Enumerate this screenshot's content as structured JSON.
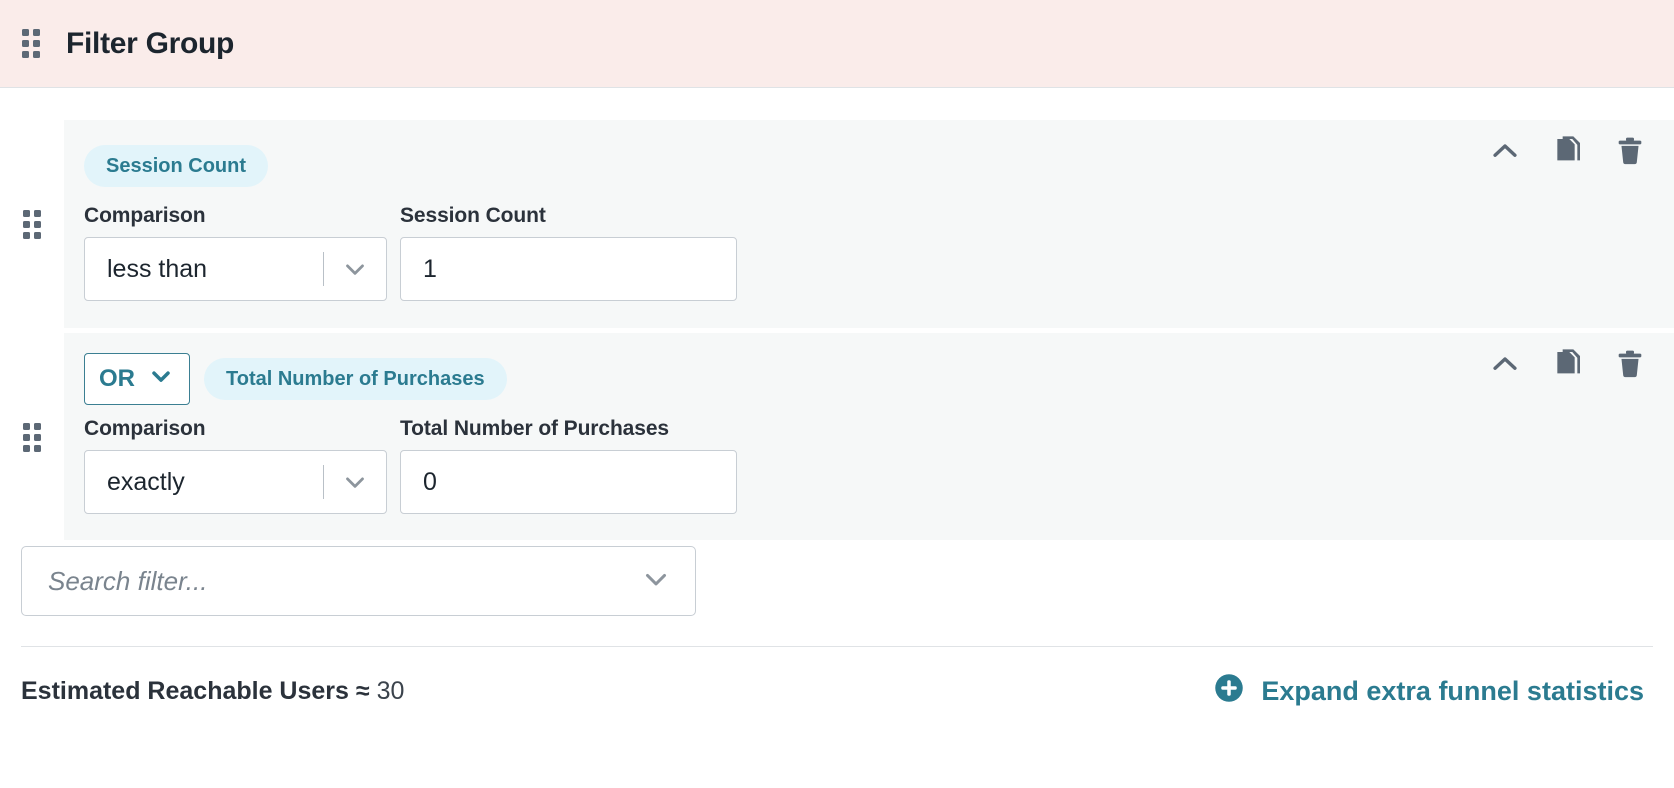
{
  "header": {
    "title": "Filter Group",
    "drag_handle_icon": "drag-handle-icon",
    "background": "#faecea"
  },
  "theme": {
    "accent_teal": "#2b7b90",
    "chip_background": "#e2f4fa",
    "card_background": "#f6f8f8",
    "icon_gray": "#5c6875"
  },
  "filters": [
    {
      "conjunction": null,
      "chip_label": "Session Count",
      "comparison_label": "Comparison",
      "comparison_value": "less than",
      "value_label": "Session Count",
      "value": "1",
      "actions": [
        "collapse-icon",
        "duplicate-icon",
        "delete-icon"
      ]
    },
    {
      "conjunction": "OR",
      "chip_label": "Total Number of Purchases",
      "comparison_label": "Comparison",
      "comparison_value": "exactly",
      "value_label": "Total Number of Purchases",
      "value": "0",
      "actions": [
        "collapse-icon",
        "duplicate-icon",
        "delete-icon"
      ]
    }
  ],
  "search": {
    "placeholder": "Search filter...",
    "value": "",
    "chevron_icon": "chevron-down-icon"
  },
  "footer": {
    "estimate_label": "Estimated Reachable Users ≈",
    "estimate_value": "30",
    "expand_label": "Expand extra funnel statistics",
    "expand_icon": "plus-circle-icon"
  }
}
